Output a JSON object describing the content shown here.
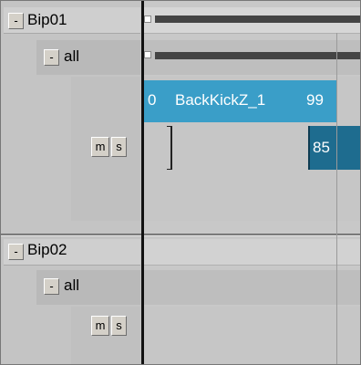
{
  "tracks": [
    {
      "name": "Bip01",
      "collapse": "-",
      "layer": {
        "name": "all",
        "collapse": "-"
      },
      "mute": "m",
      "solo": "s",
      "clip": {
        "start": "0",
        "name": "BackKickZ_1",
        "end": "99"
      },
      "next_clip_start": "85"
    },
    {
      "name": "Bip02",
      "collapse": "-",
      "layer": {
        "name": "all",
        "collapse": "-"
      },
      "mute": "m",
      "solo": "s"
    }
  ],
  "colors": {
    "clip": "#3a9ec8",
    "clip_dark": "#1e6c8f",
    "panel": "#c8c8c8"
  }
}
